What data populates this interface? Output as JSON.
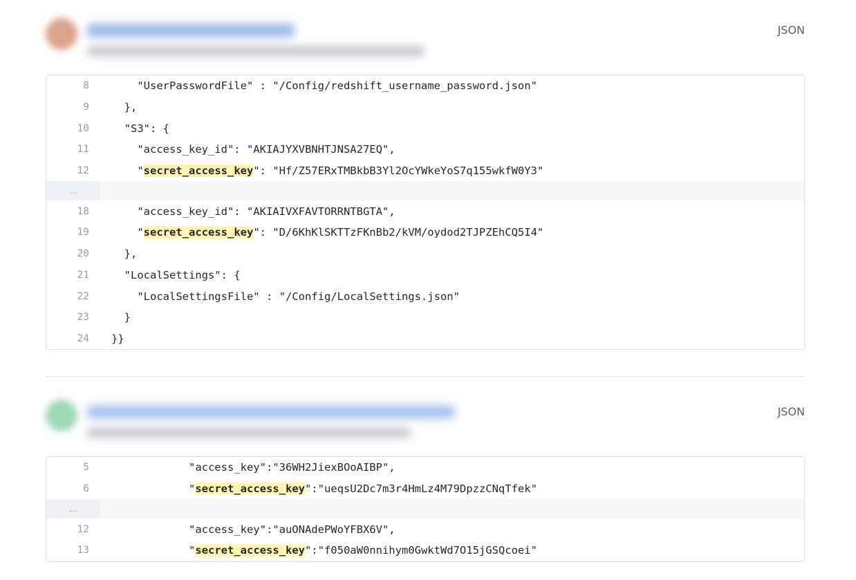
{
  "results": [
    {
      "language": "JSON",
      "lines": [
        {
          "num": "8",
          "segments": [
            {
              "t": "    \"UserPasswordFile\" : \"/Config/redshift_username_password.json\""
            }
          ]
        },
        {
          "num": "9",
          "segments": [
            {
              "t": "  },"
            }
          ]
        },
        {
          "num": "10",
          "segments": [
            {
              "t": "  \"S3\": {"
            }
          ]
        },
        {
          "num": "11",
          "segments": [
            {
              "t": "    \"access_key_id\": \"AKIAJYXVBNHTJNSA27EQ\","
            }
          ]
        },
        {
          "num": "12",
          "segments": [
            {
              "t": "    \""
            },
            {
              "t": "secret_access_key",
              "hl": true
            },
            {
              "t": "\": \"Hf/Z57ERxTMBkbB3Yl2OcYWkeYoS7q155wkfW0Y3\""
            }
          ]
        },
        {
          "gap": true,
          "label": "…"
        },
        {
          "num": "18",
          "segments": [
            {
              "t": "    \"access_key_id\": \"AKIAIVXFAVTORRNTBGTA\","
            }
          ]
        },
        {
          "num": "19",
          "segments": [
            {
              "t": "    \""
            },
            {
              "t": "secret_access_key",
              "hl": true
            },
            {
              "t": "\": \"D/6KhKlSKTTzFKnBb2/kVM/oydod2TJPZEhCQ5I4\""
            }
          ]
        },
        {
          "num": "20",
          "segments": [
            {
              "t": "  },"
            }
          ]
        },
        {
          "num": "21",
          "segments": [
            {
              "t": "  \"LocalSettings\": {"
            }
          ]
        },
        {
          "num": "22",
          "segments": [
            {
              "t": "    \"LocalSettingsFile\" : \"/Config/LocalSettings.json\""
            }
          ]
        },
        {
          "num": "23",
          "segments": [
            {
              "t": "  }"
            }
          ]
        },
        {
          "num": "24",
          "segments": [
            {
              "t": "}}"
            }
          ]
        }
      ]
    },
    {
      "language": "JSON",
      "lines": [
        {
          "num": "5",
          "segments": [
            {
              "t": "            \"access_key\":\"36WH2JiexBOoAIBP\","
            }
          ]
        },
        {
          "num": "6",
          "segments": [
            {
              "t": "            \""
            },
            {
              "t": "secret_access_key",
              "hl": true
            },
            {
              "t": "\":\"ueqsU2Dc7m3r4HmLz4M79DpzzCNqTfek\""
            }
          ]
        },
        {
          "gap": true,
          "label": "…"
        },
        {
          "num": "12",
          "segments": [
            {
              "t": "            \"access_key\":\"auONAdePWoYFBX6V\","
            }
          ]
        },
        {
          "num": "13",
          "segments": [
            {
              "t": "            \""
            },
            {
              "t": "secret_access_key",
              "hl": true
            },
            {
              "t": "\":\"f050aW0nnihym0GwktWd7O15jGSQcoei\""
            }
          ]
        }
      ]
    }
  ],
  "colors": {
    "highlight": "#fff5b1",
    "line_number": "#959da5",
    "border": "#dfe2e5",
    "avatar_1": "#d9a48a",
    "avatar_2": "#9fd8b8",
    "title_blur_1": "#9fbce8",
    "title_blur_2": "#a9c6ee"
  }
}
